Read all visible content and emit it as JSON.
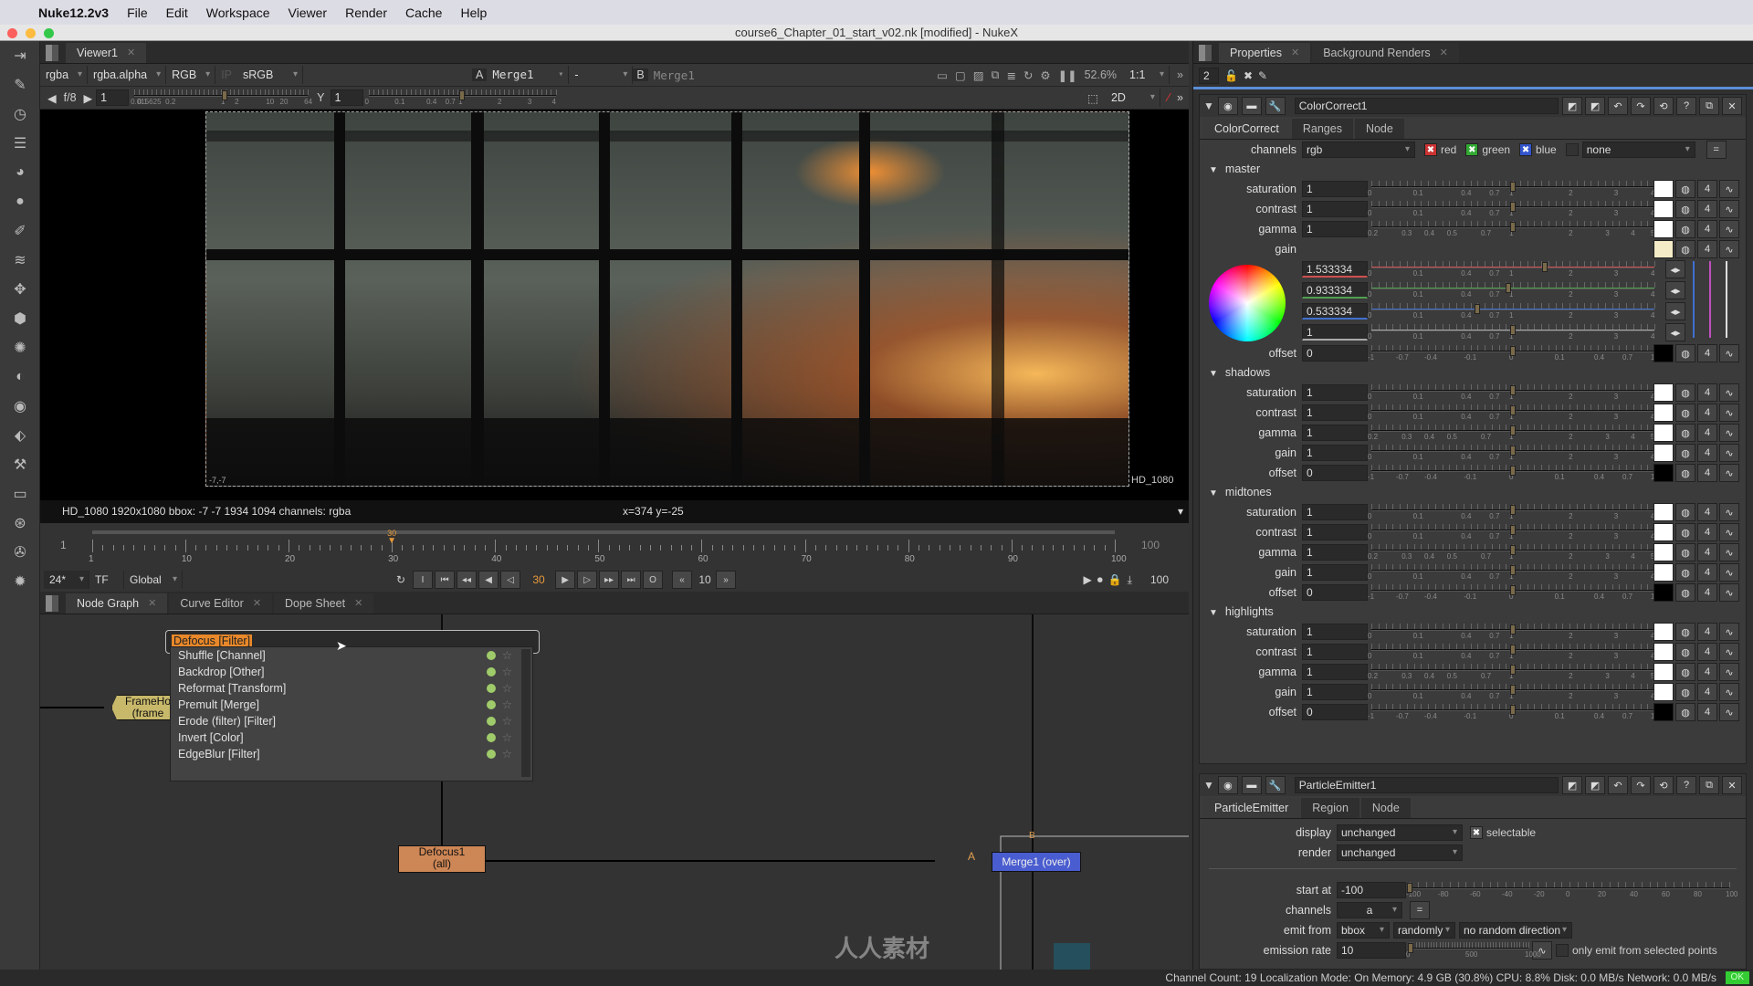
{
  "menubar": {
    "app": "Nuke12.2v3",
    "items": [
      "File",
      "Edit",
      "Workspace",
      "Viewer",
      "Render",
      "Cache",
      "Help"
    ]
  },
  "window": {
    "title": "course6_Chapter_01_start_v02.nk [modified] - NukeX"
  },
  "viewer": {
    "tab": "Viewer1",
    "toolbar": {
      "channels": "rgba",
      "alpha": "rgba.alpha",
      "display": "RGB",
      "ip": "IP",
      "lut": "sRGB",
      "a_label": "A",
      "a_input": "Merge1",
      "wipe": "-",
      "b_label": "B",
      "b_input": "Merge1",
      "zoom": "52.6%",
      "ratio": "1:1"
    },
    "toolbar2": {
      "fstop": "f/8",
      "gain": "1",
      "gain_ticks": [
        "0.015625",
        "0.1",
        "0.2",
        "1",
        "2",
        "10",
        "20",
        "64"
      ],
      "gamma_label": "Y",
      "gamma": "1",
      "gamma_ticks": [
        "0",
        "0.1",
        "0.4",
        "0.7",
        "1",
        "2",
        "3",
        "4"
      ],
      "mode": "2D"
    },
    "format_label": "HD_1080",
    "corner_label": "-7,-7",
    "status": "HD_1080 1920x1080  bbox: -7 -7 1934 1094 channels: rgba",
    "cursor": "x=374 y=-25",
    "timeline": {
      "start": "1",
      "end": "100",
      "ticks": [
        "1",
        "10",
        "20",
        "30",
        "40",
        "50",
        "60",
        "70",
        "80",
        "90",
        "100"
      ],
      "current": "30",
      "fps": "24*",
      "tf": "TF",
      "scope": "Global",
      "frame": "30",
      "increment": "10",
      "out": "100",
      "out2": "100",
      "in_marker": "I",
      "out_marker": "O"
    }
  },
  "nodegraph": {
    "tabs": [
      "Node Graph",
      "Curve Editor",
      "Dope Sheet"
    ],
    "tab_search": "Defocus [Filter]",
    "tab_results": [
      "Shuffle [Channel]",
      "Backdrop [Other]",
      "Reformat [Transform]",
      "Premult [Merge]",
      "Erode (filter) [Filter]",
      "Invert [Color]",
      "EdgeBlur [Filter]"
    ],
    "nodes": {
      "framehold": [
        "FrameHo",
        "(frame"
      ],
      "defocus": [
        "Defocus1",
        "(all)"
      ],
      "merge": "Merge1 (over)",
      "a": "A",
      "b": "B"
    },
    "watermark": "人人素材"
  },
  "properties": {
    "tabs": [
      "Properties",
      "Background Renders"
    ],
    "max_panels": "2",
    "colorcorrect": {
      "name": "ColorCorrect1",
      "tabs": [
        "ColorCorrect",
        "Ranges",
        "Node"
      ],
      "channels_label": "channels",
      "channels": "rgb",
      "red": "red",
      "green": "green",
      "blue": "blue",
      "extra": "none",
      "sections": [
        {
          "name": "master",
          "rows": [
            [
              "saturation",
              "1",
              "lin"
            ],
            [
              "contrast",
              "1",
              "lin"
            ],
            [
              "gamma",
              "1",
              "gam"
            ],
            [
              "gain",
              "",
              "gain"
            ],
            [
              "offset",
              "0",
              "off"
            ]
          ]
        },
        {
          "name": "shadows",
          "rows": [
            [
              "saturation",
              "1",
              "lin"
            ],
            [
              "contrast",
              "1",
              "lin"
            ],
            [
              "gamma",
              "1",
              "gam"
            ],
            [
              "gain",
              "1",
              "lin"
            ],
            [
              "offset",
              "0",
              "off"
            ]
          ]
        },
        {
          "name": "midtones",
          "rows": [
            [
              "saturation",
              "1",
              "lin"
            ],
            [
              "contrast",
              "1",
              "lin"
            ],
            [
              "gamma",
              "1",
              "gam"
            ],
            [
              "gain",
              "1",
              "lin"
            ],
            [
              "offset",
              "0",
              "off"
            ]
          ]
        },
        {
          "name": "highlights",
          "rows": [
            [
              "saturation",
              "1",
              "lin"
            ],
            [
              "contrast",
              "1",
              "lin"
            ],
            [
              "gamma",
              "1",
              "gam"
            ],
            [
              "gain",
              "1",
              "lin"
            ],
            [
              "offset",
              "0",
              "off"
            ]
          ]
        }
      ],
      "master_gain": [
        {
          "value": "1.533334",
          "color": "#d05050"
        },
        {
          "value": "0.933334",
          "color": "#50a050"
        },
        {
          "value": "0.533334",
          "color": "#4070d0"
        },
        {
          "value": "1",
          "color": "#aaaaaa"
        }
      ],
      "scales": {
        "lin": [
          "0",
          "0.1",
          "0.4",
          "0.7",
          "1",
          "2",
          "3",
          "4"
        ],
        "gam": [
          "0.2",
          "0.3",
          "0.4",
          "0.5",
          "0.7",
          "1",
          "2",
          "3",
          "4",
          "5"
        ],
        "off": [
          "-1",
          "-0.7",
          "-0.4",
          "-0.1",
          "0",
          "0.1",
          "0.4",
          "0.7",
          "1"
        ]
      },
      "channel_count": "4"
    },
    "particle": {
      "name": "ParticleEmitter1",
      "tabs": [
        "ParticleEmitter",
        "Region",
        "Node"
      ],
      "display_label": "display",
      "display": "unchanged",
      "selectable": "selectable",
      "render_label": "render",
      "render": "unchanged",
      "start_label": "start at",
      "start": "-100",
      "start_ticks": [
        "-100",
        "-80",
        "-60",
        "-40",
        "-20",
        "0",
        "20",
        "40",
        "60",
        "80",
        "100"
      ],
      "channels_label": "channels",
      "channels": "a",
      "emit_label": "emit from",
      "emit": "bbox",
      "emit_order": "randomly",
      "direction": "no random direction",
      "rate_label": "emission rate",
      "rate": "10",
      "rate_ticks": [
        "0",
        "500",
        "1000"
      ],
      "selected_points": "only emit from selected points"
    }
  },
  "statusbar": {
    "text": "Channel Count: 19  Localization Mode: On  Memory: 4.9 GB (30.8%)  CPU: 8.8%  Disk: 0.0 MB/s  Network: 0.0 MB/s",
    "ok": "OK"
  }
}
